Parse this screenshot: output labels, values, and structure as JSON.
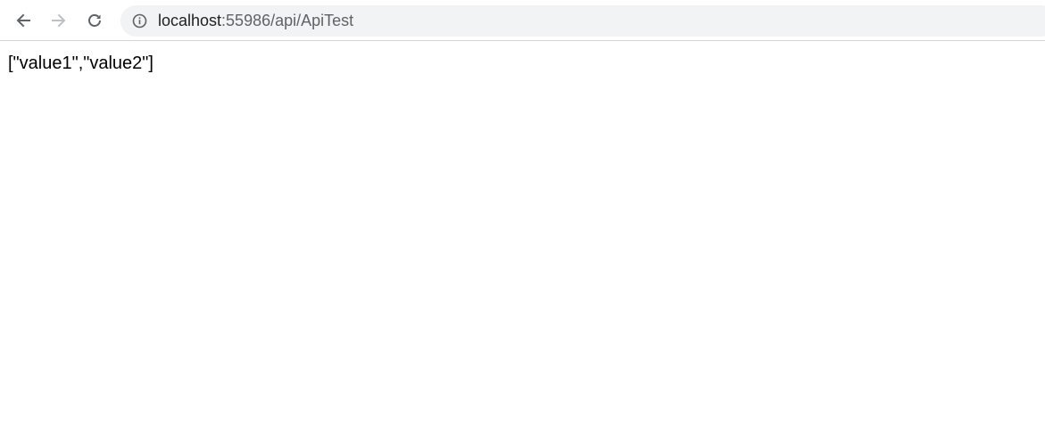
{
  "browser": {
    "url_host": "localhost",
    "url_rest": ":55986/api/ApiTest",
    "icons": {
      "back": "back-arrow-icon",
      "forward": "forward-arrow-icon",
      "reload": "reload-icon",
      "site_info": "info-icon"
    },
    "colors": {
      "toolbar_bg": "#ffffff",
      "omnibox_bg": "#f1f3f4",
      "url_host_text": "#202124",
      "url_path_text": "#5f6368",
      "icon_active": "#5f6368",
      "icon_disabled": "#bdc1c6"
    }
  },
  "page": {
    "body_text": "[\"value1\",\"value2\"]"
  }
}
